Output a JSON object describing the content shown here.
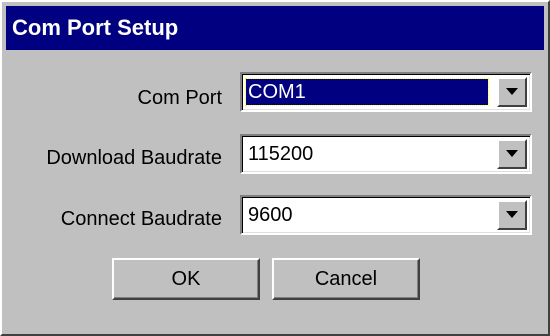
{
  "window": {
    "title": "Com Port Setup"
  },
  "fields": {
    "com_port": {
      "label": "Com Port",
      "value": "COM1"
    },
    "download_baudrate": {
      "label": "Download Baudrate",
      "value": "115200"
    },
    "connect_baudrate": {
      "label": "Connect Baudrate",
      "value": "9600"
    }
  },
  "buttons": {
    "ok_label": "OK",
    "cancel_label": "Cancel"
  },
  "icons": {
    "dropdown": "chevron-down-icon"
  },
  "colors": {
    "titlebar": "#000080",
    "selection": "#000080",
    "face": "#c0c0c0"
  }
}
